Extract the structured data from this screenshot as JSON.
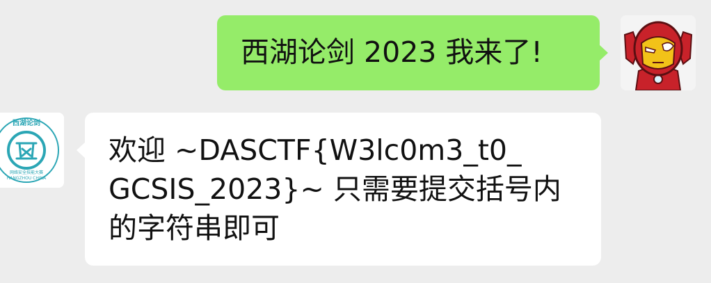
{
  "messages": [
    {
      "sender": "self",
      "avatar_icon": "iron-man-avatar-icon",
      "lines": [
        "西湖论剑 2023 我来了!"
      ]
    },
    {
      "sender": "other",
      "avatar_icon": "westlake-sword-logo-icon",
      "avatar_logo_text": {
        "top": "西湖论剑",
        "center": "剑",
        "bottom_cn": "网络安全技能大赛",
        "bottom_en": "HANGZHOU CHINA"
      },
      "lines": [
        "欢迎 ~DASCTF{W3lc0m3_t0_",
        "GCSIS_2023}~ 只需要提交括号内",
        "的字符串即可"
      ]
    }
  ],
  "colors": {
    "background": "#ededed",
    "self_bubble": "#95ec69",
    "other_bubble": "#ffffff",
    "logo_accent": "#2ba6b5"
  }
}
